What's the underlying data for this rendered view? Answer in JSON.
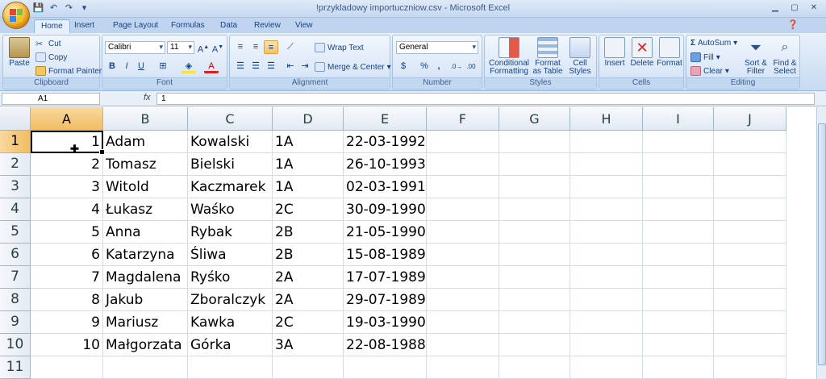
{
  "window": {
    "title": "!przykladowy importuczniow.csv - Microsoft Excel",
    "controls": [
      "minimize-icon",
      "maximize-icon",
      "close-icon"
    ]
  },
  "tabs": [
    "Home",
    "Insert",
    "Page Layout",
    "Formulas",
    "Data",
    "Review",
    "View"
  ],
  "ribbon": {
    "clipboard": {
      "title": "Clipboard",
      "paste": "Paste",
      "cut": "Cut",
      "copy": "Copy",
      "format_painter": "Format Painter"
    },
    "font": {
      "title": "Font",
      "name": "Calibri",
      "size": "11",
      "bold": "B",
      "italic": "I",
      "underline": "U"
    },
    "alignment": {
      "title": "Alignment",
      "wrap_text": "Wrap Text",
      "merge_center": "Merge & Center"
    },
    "number": {
      "title": "Number",
      "format": "General",
      "currency": "$",
      "percent": "%",
      "comma": ","
    },
    "styles": {
      "title": "Styles",
      "conditional": "Conditional Formatting",
      "table": "Format as Table",
      "cell_styles": "Cell Styles"
    },
    "cells": {
      "title": "Cells",
      "insert": "Insert",
      "delete": "Delete",
      "format": "Format"
    },
    "editing": {
      "title": "Editing",
      "autosum": "AutoSum",
      "fill": "Fill",
      "clear": "Clear",
      "sort_filter": "Sort & Filter",
      "find_select": "Find & Select"
    }
  },
  "formula_bar": {
    "name_box": "A1",
    "fx": "fx",
    "value": "1"
  },
  "sheet": {
    "columns": [
      "A",
      "B",
      "C",
      "D",
      "E",
      "F",
      "G",
      "H",
      "I",
      "J"
    ],
    "selected_column": "A",
    "selected_row": 1,
    "row_numbers": [
      "1",
      "2",
      "3",
      "4",
      "5",
      "6",
      "7",
      "8",
      "9",
      "10",
      "11"
    ],
    "rows": [
      [
        "1",
        "Adam",
        "Kowalski",
        "1A",
        "22-03-1992"
      ],
      [
        "2",
        "Tomasz",
        "Bielski",
        "1A",
        "26-10-1993"
      ],
      [
        "3",
        "Witold",
        "Kaczmarek",
        "1A",
        "02-03-1991"
      ],
      [
        "4",
        "Łukasz",
        "Waśko",
        "2C",
        "30-09-1990"
      ],
      [
        "5",
        "Anna",
        "Rybak",
        "2B",
        "21-05-1990"
      ],
      [
        "6",
        "Katarzyna",
        "Śliwa",
        "2B",
        "15-08-1989"
      ],
      [
        "7",
        "Magdalena",
        "Ryśko",
        "2A",
        "17-07-1989"
      ],
      [
        "8",
        "Jakub",
        "Zboralczyk",
        "2A",
        "29-07-1989"
      ],
      [
        "9",
        "Mariusz",
        "Kawka",
        "2C",
        "19-03-1990"
      ],
      [
        "10",
        "Małgorzata",
        "Górka",
        "3A",
        "22-08-1988"
      ]
    ]
  }
}
